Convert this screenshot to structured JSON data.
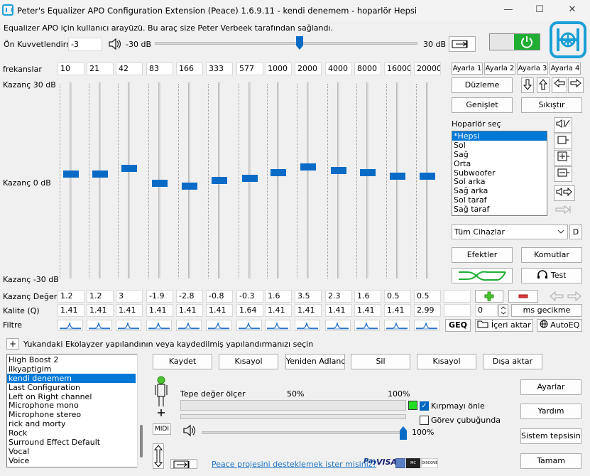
{
  "window": {
    "title": "Peter's Equalizer APO Configuration Extension (Peace) 1.6.9.11 - kendi denemem - hoparlör Hepsi",
    "minimize": "—",
    "maximize": "☐",
    "close": "✕"
  },
  "header": {
    "subtitle": "Equalizer APO için kullanıcı arayüzü. Bu araç size Peter Verbeek tarafından sağlandı.",
    "preamp_label": "Ön Kuvvetlendirme",
    "preamp_value": "-3",
    "preamp_min": "-30 dB",
    "preamp_max": "30 dB",
    "preamp_fraction": 0.55
  },
  "eq": {
    "freq_label": "frekanslar",
    "frequencies": [
      "10",
      "21",
      "42",
      "83",
      "166",
      "333",
      "577",
      "1000",
      "2000",
      "4000",
      "8000",
      "16000",
      "20000"
    ],
    "gain_top": "Kazanç 30 dB",
    "gain_mid": "Kazanç 0 dB",
    "gain_bottom": "Kazanç -30 dB",
    "gains": [
      1.2,
      1.2,
      3,
      -1.9,
      -2.8,
      -0.8,
      -0.3,
      1.6,
      3.5,
      2.3,
      1.6,
      0.5,
      0.5
    ],
    "gain_value_label": "Kazanç Değeri",
    "gain_values": [
      "1.2",
      "1.2",
      "3",
      "-1.9",
      "-2.8",
      "-0.8",
      "-0.3",
      "1.6",
      "3.5",
      "2.3",
      "1.6",
      "0.5",
      "0.5"
    ],
    "quality_label": "Kalite (Q)",
    "quality_values": [
      "1.41",
      "1.41",
      "1.41",
      "1.41",
      "1.41",
      "1.41",
      "1.64",
      "1.41",
      "1.41",
      "1.41",
      "1.41",
      "1.41",
      "2.99"
    ],
    "filter_label": "Filtre"
  },
  "right": {
    "settings": [
      "Ayarla 1",
      "Ayarla 2",
      "Ayarla 3",
      "Ayarla 4"
    ],
    "flatten": "Düzleme",
    "expand": "Genişlet",
    "compress": "Sıkıştır",
    "speaker_label": "Hoparlör seç",
    "speakers": [
      "*Hepsi",
      "Sol",
      "Sağ",
      "Orta",
      "Subwoofer",
      "Sol arka",
      "Sağ arka",
      "Sol taraf",
      "Sağ taraf"
    ],
    "device": "Tüm Cihazlar",
    "device_d": "D",
    "effects": "Efektler",
    "commands": "Komutlar",
    "test": "Test",
    "delay_value": "0",
    "delay_unit": "ms gecikme",
    "geq": "GEQ",
    "import": "İçeri aktar",
    "autoeq": "AutoEQ"
  },
  "presets": {
    "caption": "Yukandaki Ekolayzer yapılandının veya kaydedilmiş yapılandırmanızı seçin",
    "expand_toggle": "+",
    "items": [
      "High Boost 2",
      "ilkyaptigim",
      "kendi denemem",
      "Last Configuration",
      "Left on Right channel",
      "Microphone mono",
      "Microphone stereo",
      "rick and morty",
      "Rock",
      "Surround Effect Default",
      "Vocal",
      "Voice"
    ],
    "selected": 2,
    "save": "Kaydet",
    "shortcut": "Kısayol",
    "rename": "Yeniden Adlandır",
    "delete": "Sil",
    "shortcut2": "Kısayol",
    "export": "Dışa aktar"
  },
  "meter": {
    "label": "Tepe değer ölçer",
    "p50": "50%",
    "p100": "100%",
    "clip_prevent": "Kırpmayı önle",
    "taskbar": "Görev çubuğunda",
    "volume": "100%",
    "midi": "MIDI",
    "volume_fraction": 1.0
  },
  "side": {
    "settings": "Ayarlar",
    "help": "Yardım",
    "tray": "Sistem tepsisine",
    "done": "Tamam"
  },
  "footer": {
    "support": "Peace projesini desteklemek ister misiniz?",
    "paypal": "PayPal",
    "visa": "VISA",
    "mastercard": "MC",
    "discover": "DISCOVER"
  },
  "colors": {
    "accent": "#0a6bc7",
    "power": "#1fae33",
    "selection": "#0078d7",
    "logo": "#1a9fd6"
  }
}
